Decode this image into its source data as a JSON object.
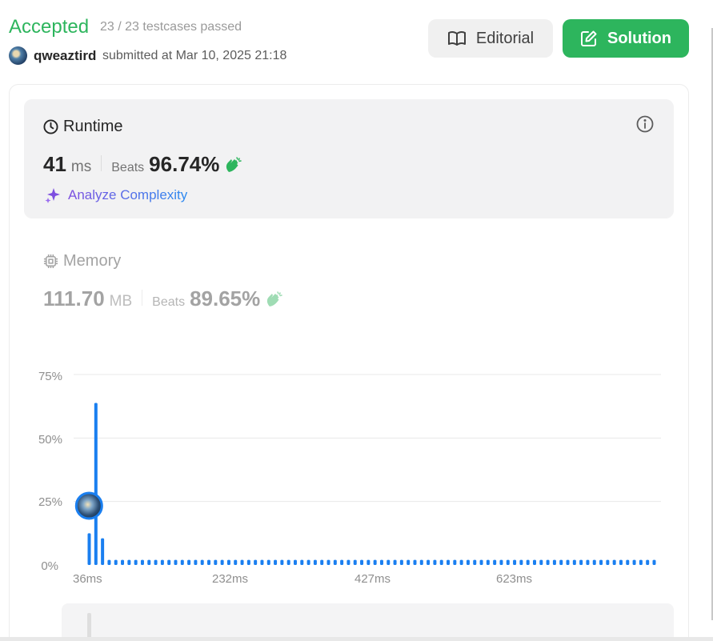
{
  "status": {
    "title": "Accepted",
    "testcases": "23 / 23 testcases passed",
    "username": "qweaztird",
    "submitted": "submitted at Mar 10, 2025 21:18"
  },
  "buttons": {
    "editorial": "Editorial",
    "solution": "Solution"
  },
  "runtime": {
    "label": "Runtime",
    "value": "41",
    "unit": "ms",
    "beats_label": "Beats",
    "beats_pct": "96.74%",
    "analyze": "Analyze Complexity"
  },
  "memory": {
    "label": "Memory",
    "value": "111.70",
    "unit": "MB",
    "beats_label": "Beats",
    "beats_pct": "89.65%"
  },
  "colors": {
    "accepted": "#2db55d",
    "bar": "#1a7ff0",
    "analyze_start": "#7e4fe0",
    "analyze_end": "#2b8af0"
  },
  "chart_data": {
    "type": "bar",
    "y_ticks": [
      "75%",
      "50%",
      "25%",
      "0%"
    ],
    "x_ticks": [
      "36ms",
      "232ms",
      "427ms",
      "623ms"
    ],
    "ylim": [
      0,
      75
    ],
    "values": [
      12.5,
      63.8,
      10.5,
      2,
      2,
      2,
      2,
      2,
      2,
      2,
      2,
      2,
      2,
      2,
      2,
      2,
      2,
      2,
      2,
      2,
      2,
      2,
      2,
      2,
      2,
      2,
      2,
      2,
      2,
      2,
      2,
      2,
      2,
      2,
      2,
      2,
      2,
      2,
      2,
      2,
      2,
      2,
      2,
      2,
      2,
      2,
      2,
      2,
      2,
      2,
      2,
      2,
      2,
      2,
      2,
      2,
      2,
      2,
      2,
      2,
      2,
      2,
      2,
      2,
      2,
      2,
      2,
      2,
      2,
      2,
      2,
      2,
      2,
      2,
      2,
      2,
      2,
      2,
      2,
      2,
      2,
      2,
      2,
      2,
      2,
      2
    ],
    "marker_index": 1,
    "marker_value": 23.3,
    "grid": true
  }
}
